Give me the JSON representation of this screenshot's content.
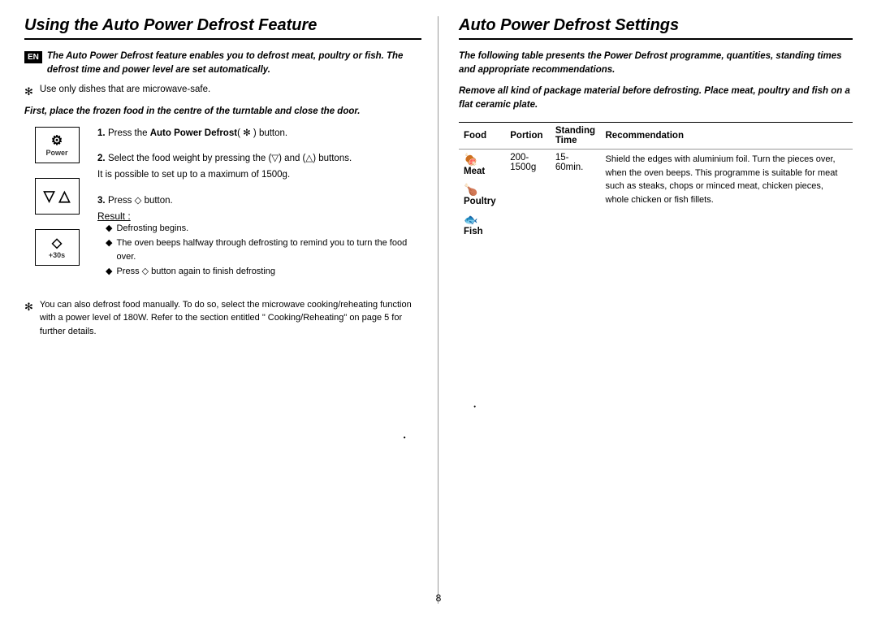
{
  "left": {
    "title": "Using the Auto Power Defrost Feature",
    "en_badge": "EN",
    "intro": "The Auto Power Defrost feature enables you to defrost meat, poultry or fish. The defrost time and power level are set automatically.",
    "note1": "Use only dishes that are microwave-safe.",
    "note2": "First, place the frozen food in the centre of the turntable and close the door.",
    "steps": [
      {
        "num": "1.",
        "text": "Press the ",
        "bold": "Auto Power Defrost",
        "text2": "( ) button."
      },
      {
        "num": "2.",
        "text": "Select the food weight by pressing the (▽) and (△) buttons.",
        "sub": "It is possible to set up to a maximum of 1500g."
      },
      {
        "num": "3.",
        "text": "Press  button.",
        "result_label": "Result :",
        "bullets": [
          "Defrosting begins.",
          "The oven beeps halfway through defrosting to remind you to turn the food over.",
          "Press  button again to finish defrosting"
        ]
      }
    ],
    "manual_note": "You can also defrost food manually. To do so, select the microwave cooking/reheating function with a power level of 180W. Refer to the section entitled \" Cooking/Reheating\" on page 5 for further details."
  },
  "right": {
    "title": "Auto Power Defrost Settings",
    "intro": "The following table presents the Power Defrost programme, quantities, standing times and appropriate recommendations.",
    "warning": "Remove all kind of package material before defrosting. Place meat, poultry and fish on a flat ceramic plate.",
    "table": {
      "headers": [
        "Food",
        "Portion",
        "Standing Time",
        "Recommendation"
      ],
      "rows": [
        {
          "food_icon": "🍖",
          "food": "Meat",
          "portion": "200-1500g",
          "standing": "15-60min.",
          "recommendation": "Shield the edges with aluminium foil. Turn the pieces over, when the oven beeps. This programme is suitable for meat such as steaks, chops or minced meat, chicken pieces, whole chicken or fish fillets."
        },
        {
          "food_icon": "🍗",
          "food": "Poultry",
          "portion": "",
          "standing": "",
          "recommendation": ""
        },
        {
          "food_icon": "🐟",
          "food": "Fish",
          "portion": "",
          "standing": "",
          "recommendation": ""
        }
      ]
    }
  },
  "page_number": "8"
}
